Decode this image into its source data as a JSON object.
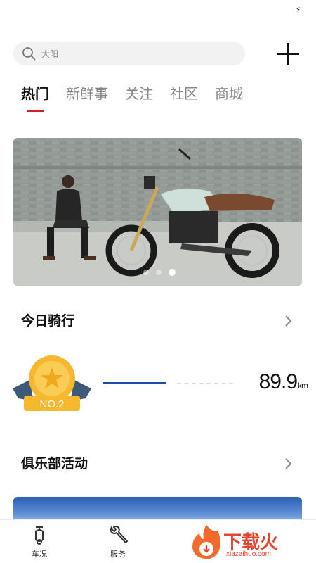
{
  "status_bar": {
    "flash_icon": "flash-icon"
  },
  "search": {
    "placeholder": "大阳",
    "icon": "search-icon"
  },
  "header": {
    "add_icon": "plus-icon"
  },
  "tabs": [
    {
      "label": "热门",
      "active": true
    },
    {
      "label": "新鲜事",
      "active": false
    },
    {
      "label": "关注",
      "active": false
    },
    {
      "label": "社区",
      "active": false
    },
    {
      "label": "商城",
      "active": false
    }
  ],
  "banner": {
    "slides": 3,
    "active_slide": 3
  },
  "today_riding": {
    "title": "今日骑行",
    "rank_badge": "NO.2",
    "distance": "89.9",
    "unit": "km",
    "progress_fraction": 0.55
  },
  "club": {
    "title": "俱乐部活动"
  },
  "bottom_nav": [
    {
      "label": "车况",
      "icon": "scooter-icon"
    },
    {
      "label": "服务",
      "icon": "wrench-icon"
    }
  ],
  "watermark": {
    "text": "下载火",
    "domain": "xiazaihuo.com"
  },
  "colors": {
    "accent": "#d21e28",
    "progress": "#1f4aa8",
    "badge_gold": "#f5b82e",
    "badge_ribbon": "#3f5a78"
  }
}
